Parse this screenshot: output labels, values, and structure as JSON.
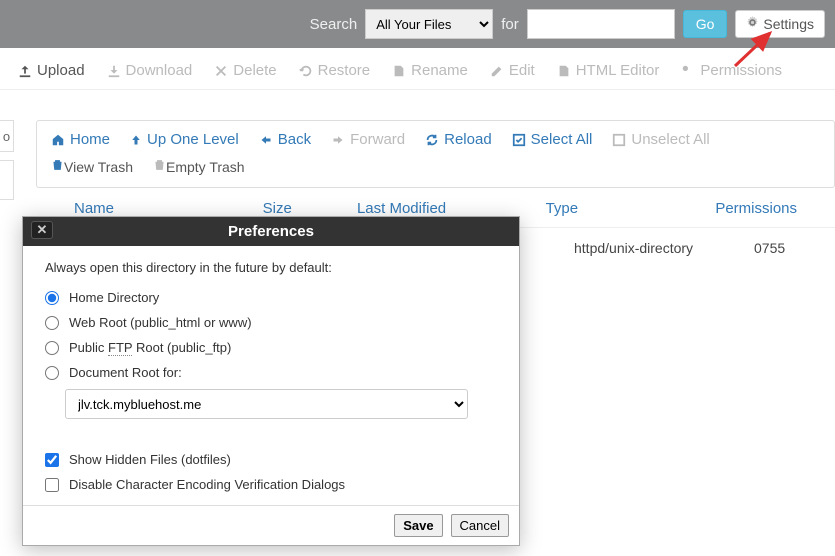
{
  "topbar": {
    "search_label": "Search",
    "search_scope": "All Your Files",
    "for_label": "for",
    "search_value": "",
    "go": "Go",
    "settings": "Settings"
  },
  "toolbar": {
    "upload": "Upload",
    "download": "Download",
    "delete": "Delete",
    "restore": "Restore",
    "rename": "Rename",
    "edit": "Edit",
    "html_editor": "HTML Editor",
    "permissions": "Permissions"
  },
  "leftsliver": {
    "letter": "o"
  },
  "nav": {
    "home": "Home",
    "up": "Up One Level",
    "back": "Back",
    "forward": "Forward",
    "reload": "Reload",
    "select_all": "Select All",
    "unselect_all": "Unselect All",
    "view_trash": "View Trash",
    "empty_trash": "Empty Trash"
  },
  "table": {
    "headers": {
      "name": "Name",
      "size": "Size",
      "modified": "Last Modified",
      "type": "Type",
      "perms": "Permissions"
    },
    "rows": [
      {
        "type": "httpd/unix-directory",
        "perms": "0755"
      }
    ]
  },
  "modal": {
    "title": "Preferences",
    "intro": "Always open this directory in the future by default:",
    "opt_home": "Home Directory",
    "opt_webroot": "Web Root (public_html or www)",
    "opt_ftp_pre": "Public ",
    "opt_ftp_abbr": "FTP",
    "opt_ftp_post": " Root (public_ftp)",
    "opt_docroot": "Document Root for:",
    "docroot_value": "jlv.tck.mybluehost.me",
    "chk_hidden": "Show Hidden Files (dotfiles)",
    "chk_encoding": "Disable Character Encoding Verification Dialogs",
    "save": "Save",
    "cancel": "Cancel"
  }
}
